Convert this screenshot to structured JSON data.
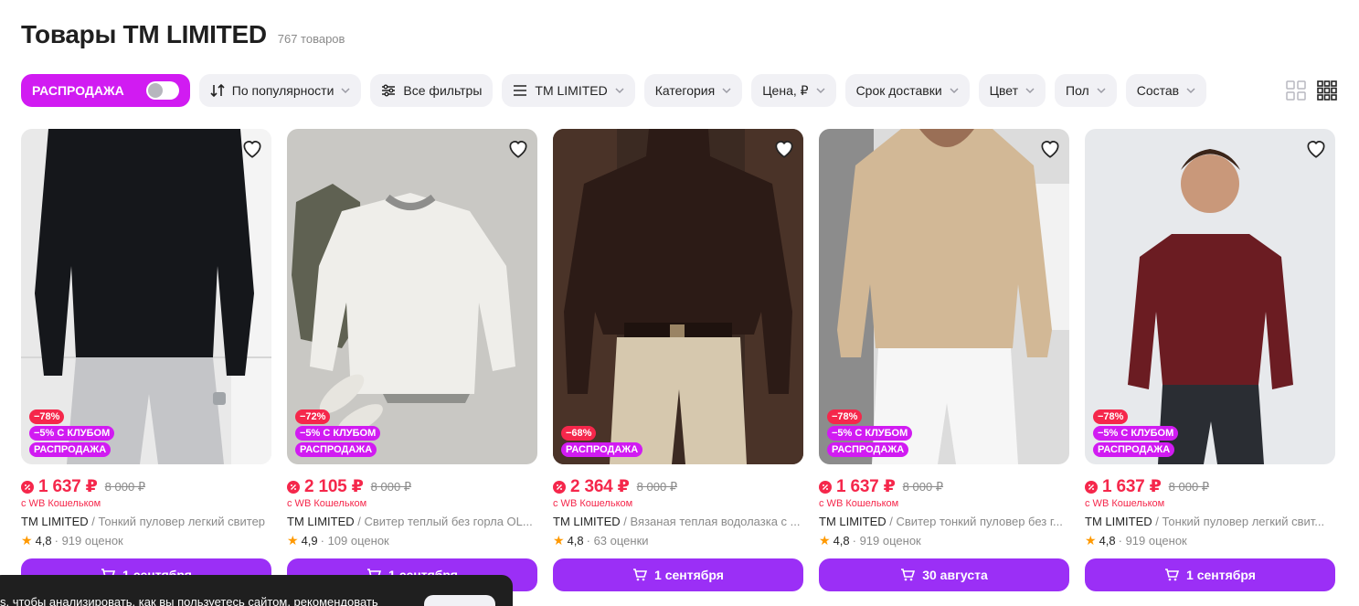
{
  "page": {
    "title": "Товары TM LIMITED",
    "count": "767 товаров"
  },
  "filters": {
    "sale_label": "РАСПРОДАЖА",
    "sale_enabled": false,
    "chips": [
      {
        "label": "По популярности",
        "icon": "sort-icon"
      },
      {
        "label": "Все фильтры",
        "icon": "filters-icon"
      },
      {
        "label": "TM LIMITED",
        "icon": "list-icon"
      },
      {
        "label": "Категория"
      },
      {
        "label": "Цена, ₽"
      },
      {
        "label": "Срок доставки"
      },
      {
        "label": "Цвет"
      },
      {
        "label": "Пол"
      },
      {
        "label": "Состав"
      }
    ],
    "view_modes": [
      "grid-2x2-icon",
      "grid-3x3-icon"
    ],
    "active_view": "grid-3x3-icon"
  },
  "products": [
    {
      "discount": "−78%",
      "club": "−5% С КЛУБОМ",
      "sale": "РАСПРОДАЖА",
      "price": "1 637 ₽",
      "old_price": "8 000 ₽",
      "wallet": "с WB Кошельком",
      "brand": "TM LIMITED",
      "desc": " / Тонкий пуловер легкий свитер",
      "rating": "4,8",
      "reviews": "· 919 оценок",
      "delivery": "1 сентября"
    },
    {
      "discount": "−72%",
      "club": "−5% С КЛУБОМ",
      "sale": "РАСПРОДАЖА",
      "price": "2 105 ₽",
      "old_price": "8 000 ₽",
      "wallet": "с WB Кошельком",
      "brand": "TM LIMITED",
      "desc": " / Свитер теплый без горла OL...",
      "rating": "4,9",
      "reviews": "· 109 оценок",
      "delivery": "1 сентября"
    },
    {
      "discount": "−68%",
      "club": "",
      "sale": "РАСПРОДАЖА",
      "price": "2 364 ₽",
      "old_price": "8 000 ₽",
      "wallet": "с WB Кошельком",
      "brand": "TM LIMITED",
      "desc": " / Вязаная теплая водолазка с ...",
      "rating": "4,8",
      "reviews": "· 63 оценки",
      "delivery": "1 сентября"
    },
    {
      "discount": "−78%",
      "club": "−5% С КЛУБОМ",
      "sale": "РАСПРОДАЖА",
      "price": "1 637 ₽",
      "old_price": "8 000 ₽",
      "wallet": "с WB Кошельком",
      "brand": "TM LIMITED",
      "desc": " / Свитер тонкий пуловер без г...",
      "rating": "4,8",
      "reviews": "· 919 оценок",
      "delivery": "30 августа"
    },
    {
      "discount": "−78%",
      "club": "−5% С КЛУБОМ",
      "sale": "РАСПРОДАЖА",
      "price": "1 637 ₽",
      "old_price": "8 000 ₽",
      "wallet": "с WB Кошельком",
      "brand": "TM LIMITED",
      "desc": " / Тонкий пуловер легкий свит...",
      "rating": "4,8",
      "reviews": "· 919 оценок",
      "delivery": "1 сентября"
    }
  ],
  "cookie": {
    "text": "s, чтобы анализировать, как вы пользуетесь сайтом, рекомендовать"
  },
  "colors": {
    "accent": "#d11bf2",
    "price": "#f5274b",
    "button": "#9b2ff6"
  }
}
